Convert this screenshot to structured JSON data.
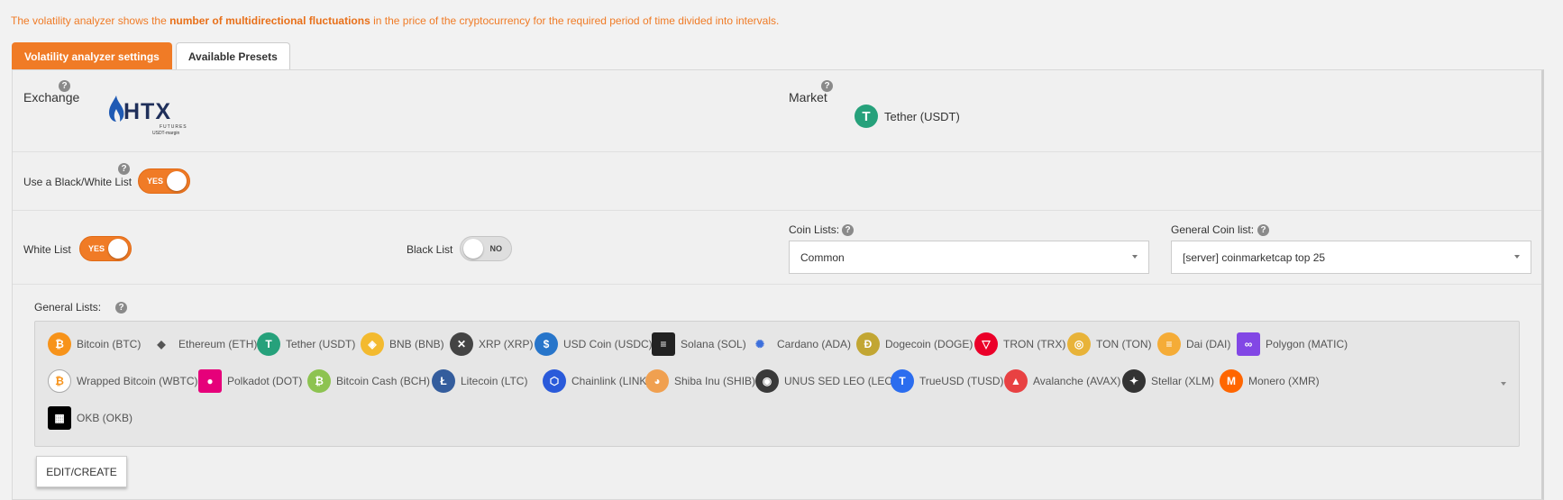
{
  "intro": {
    "before": "The volatility analyzer shows the ",
    "bold": "number of multidirectional fluctuations",
    "after": " in the price of the cryptocurrency for the required period of time divided into intervals."
  },
  "tabs": [
    {
      "label": "Volatility analyzer settings",
      "active": true
    },
    {
      "label": "Available Presets",
      "active": false
    }
  ],
  "exchange": {
    "label": "Exchange",
    "logo_text": "HTX",
    "logo_sub1": "FUTURES",
    "logo_sub2": "USDT-margin"
  },
  "market": {
    "label": "Market",
    "value": "Tether (USDT)"
  },
  "black_white": {
    "label": "Use a Black/White List",
    "state": "YES"
  },
  "white_list": {
    "label": "White List",
    "state": "YES"
  },
  "black_list": {
    "label": "Black List",
    "state": "NO"
  },
  "coin_lists": {
    "label": "Coin Lists:",
    "value": "Common"
  },
  "general_coin_list": {
    "label": "General Coin list:",
    "value": "[server] coinmarketcap top 25"
  },
  "general_lists": {
    "label": "General Lists:",
    "coins": [
      {
        "name": "Bitcoin (BTC)",
        "icon": "bitcoin-icon",
        "color": "#f7931a",
        "glyph": "₿"
      },
      {
        "name": "Ethereum (ETH)",
        "icon": "ethereum-icon",
        "color": "#6b6b6b",
        "glyph": "◆"
      },
      {
        "name": "Tether (USDT)",
        "icon": "tether-icon",
        "color": "#26a17b",
        "glyph": "T"
      },
      {
        "name": "BNB (BNB)",
        "icon": "bnb-icon",
        "color": "#f3ba2f",
        "glyph": "◈"
      },
      {
        "name": "XRP (XRP)",
        "icon": "xrp-icon",
        "color": "#444444",
        "glyph": "✕"
      },
      {
        "name": "USD Coin (USDC)",
        "icon": "usdc-icon",
        "color": "#2775ca",
        "glyph": "$"
      },
      {
        "name": "Solana (SOL)",
        "icon": "solana-icon",
        "color": "#222222",
        "glyph": "≡"
      },
      {
        "name": "Cardano (ADA)",
        "icon": "cardano-icon",
        "color": "#3c6fdc",
        "glyph": "✺"
      },
      {
        "name": "Dogecoin (DOGE)",
        "icon": "dogecoin-icon",
        "color": "#c2a633",
        "glyph": "Ð"
      },
      {
        "name": "TRON (TRX)",
        "icon": "tron-icon",
        "color": "#eb0029",
        "glyph": "▽"
      },
      {
        "name": "TON (TON)",
        "icon": "ton-icon",
        "color": "#e8b339",
        "glyph": "◎"
      },
      {
        "name": "Dai (DAI)",
        "icon": "dai-icon",
        "color": "#f5ac37",
        "glyph": "≡"
      },
      {
        "name": "Polygon (MATIC)",
        "icon": "polygon-icon",
        "color": "#8247e5",
        "glyph": "∞"
      },
      {
        "name": "Wrapped Bitcoin (WBTC)",
        "icon": "wrapped-bitcoin-icon",
        "color": "#ffffff",
        "glyph": "₿"
      },
      {
        "name": "Polkadot (DOT)",
        "icon": "polkadot-icon",
        "color": "#e6007a",
        "glyph": "●"
      },
      {
        "name": "Bitcoin Cash (BCH)",
        "icon": "bitcoin-cash-icon",
        "color": "#8dc351",
        "glyph": "₿"
      },
      {
        "name": "Litecoin (LTC)",
        "icon": "litecoin-icon",
        "color": "#345d9d",
        "glyph": "Ł"
      },
      {
        "name": "Chainlink (LINK)",
        "icon": "chainlink-icon",
        "color": "#2a5ada",
        "glyph": "⬡"
      },
      {
        "name": "Shiba Inu (SHIB)",
        "icon": "shiba-inu-icon",
        "color": "#f0a050",
        "glyph": "◕"
      },
      {
        "name": "UNUS SED LEO (LEO)",
        "icon": "leo-icon",
        "color": "#3a3a3a",
        "glyph": "◉"
      },
      {
        "name": "TrueUSD (TUSD)",
        "icon": "trueusd-icon",
        "color": "#2b6def",
        "glyph": "T"
      },
      {
        "name": "Avalanche (AVAX)",
        "icon": "avalanche-icon",
        "color": "#e84142",
        "glyph": "▲"
      },
      {
        "name": "Stellar (XLM)",
        "icon": "stellar-icon",
        "color": "#333333",
        "glyph": "✦"
      },
      {
        "name": "Monero (XMR)",
        "icon": "monero-icon",
        "color": "#ff6600",
        "glyph": "M"
      },
      {
        "name": "OKB (OKB)",
        "icon": "okb-icon",
        "color": "#000000",
        "glyph": "▦"
      }
    ]
  },
  "edit_button": "EDIT/CREATE",
  "help_glyph": "?"
}
